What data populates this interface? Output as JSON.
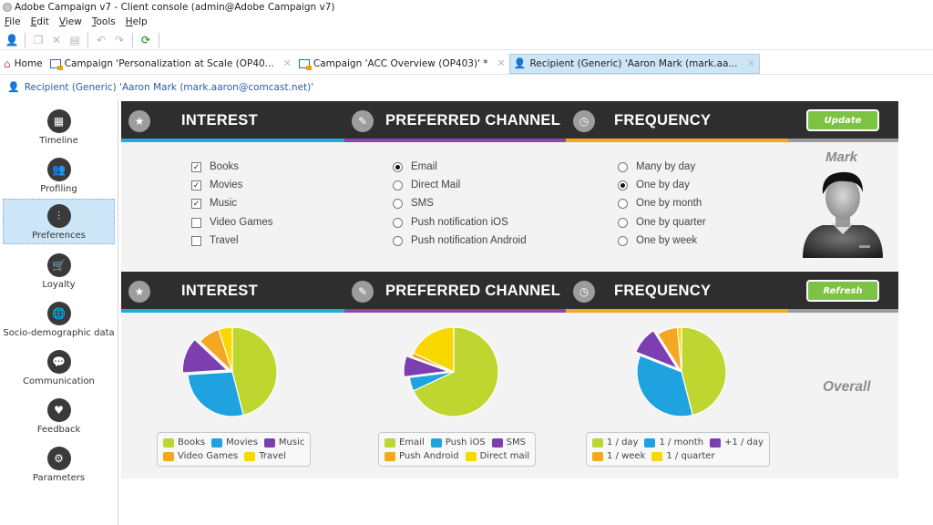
{
  "window": {
    "title": "Adobe Campaign v7 - Client console (admin@Adobe Campaign v7)"
  },
  "menu": [
    "File",
    "Edit",
    "View",
    "Tools",
    "Help"
  ],
  "toolbar": {
    "icons": [
      "new-recipient-icon",
      "copy-icon",
      "cut-icon",
      "paste-icon",
      "undo-icon",
      "redo-icon",
      "refresh-icon"
    ]
  },
  "tabs": [
    {
      "label": "Home",
      "icon": "home-icon",
      "closable": false,
      "active": false
    },
    {
      "label": "Campaign 'Personalization at Scale (OP40...",
      "icon": "campaign-icon",
      "closable": true,
      "active": false
    },
    {
      "label": "Campaign 'ACC Overview (OP403)' *",
      "icon": "campaign-icon",
      "closable": true,
      "active": false
    },
    {
      "label": "Recipient (Generic) 'Aaron Mark (mark.aa...",
      "icon": "person-icon",
      "closable": true,
      "active": true
    }
  ],
  "breadcrumb": "Recipient (Generic) 'Aaron Mark (mark.aaron@comcast.net)'",
  "sidebar": {
    "items": [
      {
        "label": "Timeline",
        "icon": "calendar-icon",
        "glyph": "▦",
        "active": false
      },
      {
        "label": "Profiling",
        "icon": "users-icon",
        "glyph": "👥",
        "active": false
      },
      {
        "label": "Preferences",
        "icon": "sliders-icon",
        "glyph": "⫶",
        "active": true
      },
      {
        "label": "Loyalty",
        "icon": "cart-icon",
        "glyph": "🛒",
        "active": false
      },
      {
        "label": "Socio-demographic data",
        "icon": "globe-icon",
        "glyph": "🌐",
        "active": false
      },
      {
        "label": "Communication",
        "icon": "chat-icon",
        "glyph": "💬",
        "active": false
      },
      {
        "label": "Feedback",
        "icon": "heart-icon",
        "glyph": "♥",
        "active": false
      },
      {
        "label": "Parameters",
        "icon": "gear-icon",
        "glyph": "⚙",
        "active": false
      }
    ]
  },
  "headers": {
    "interest": "INTEREST",
    "channel": "PREFERRED CHANNEL",
    "frequency": "FREQUENCY",
    "update_label": "Update",
    "refresh_label": "Refresh",
    "colors": {
      "interest": "#1fa9e0",
      "channel": "#8e44ad",
      "frequency": "#f5a623",
      "rest": "#9a9a9a"
    }
  },
  "preferences": {
    "interests": [
      {
        "label": "Books",
        "checked": true
      },
      {
        "label": "Movies",
        "checked": true
      },
      {
        "label": "Music",
        "checked": true
      },
      {
        "label": "Video Games",
        "checked": false
      },
      {
        "label": "Travel",
        "checked": false
      }
    ],
    "channels": [
      {
        "label": "Email",
        "selected": true
      },
      {
        "label": "Direct Mail",
        "selected": false
      },
      {
        "label": "SMS",
        "selected": false
      },
      {
        "label": "Push notification iOS",
        "selected": false
      },
      {
        "label": "Push notification Android",
        "selected": false
      }
    ],
    "frequencies": [
      {
        "label": "Many by day",
        "selected": false
      },
      {
        "label": "One by day",
        "selected": true
      },
      {
        "label": "One by month",
        "selected": false
      },
      {
        "label": "One by quarter",
        "selected": false
      },
      {
        "label": "One by week",
        "selected": false
      }
    ],
    "profile_name": "Mark"
  },
  "overall_label": "Overall",
  "chart_data": [
    {
      "type": "pie",
      "title": "Interest",
      "categories": [
        "Books",
        "Movies",
        "Music",
        "Video Games",
        "Travel"
      ],
      "values": [
        46,
        28,
        13,
        8,
        5
      ],
      "colors": [
        "#bfd630",
        "#1fa3e0",
        "#7d3fb0",
        "#f5a623",
        "#f8d800"
      ],
      "exploded": [
        "Music"
      ],
      "legend": "bottom"
    },
    {
      "type": "pie",
      "title": "Preferred Channel",
      "categories": [
        "Email",
        "Push iOS",
        "SMS",
        "Push Android",
        "Direct mail"
      ],
      "values": [
        68,
        5,
        7.5,
        1.5,
        18
      ],
      "colors": [
        "#bfd630",
        "#1fa3e0",
        "#7d3fb0",
        "#f5a623",
        "#f8d800"
      ],
      "exploded": [
        "SMS"
      ],
      "legend": "bottom"
    },
    {
      "type": "pie",
      "title": "Frequency",
      "categories": [
        "1 / day",
        "1 / month",
        "+1 / day",
        "1 / week",
        "1 / quarter"
      ],
      "values": [
        46,
        35,
        10,
        7.5,
        1.5
      ],
      "colors": [
        "#bfd630",
        "#1fa3e0",
        "#7d3fb0",
        "#f5a623",
        "#f8d800"
      ],
      "exploded": [
        "+1 / day"
      ],
      "legend": "bottom"
    }
  ]
}
